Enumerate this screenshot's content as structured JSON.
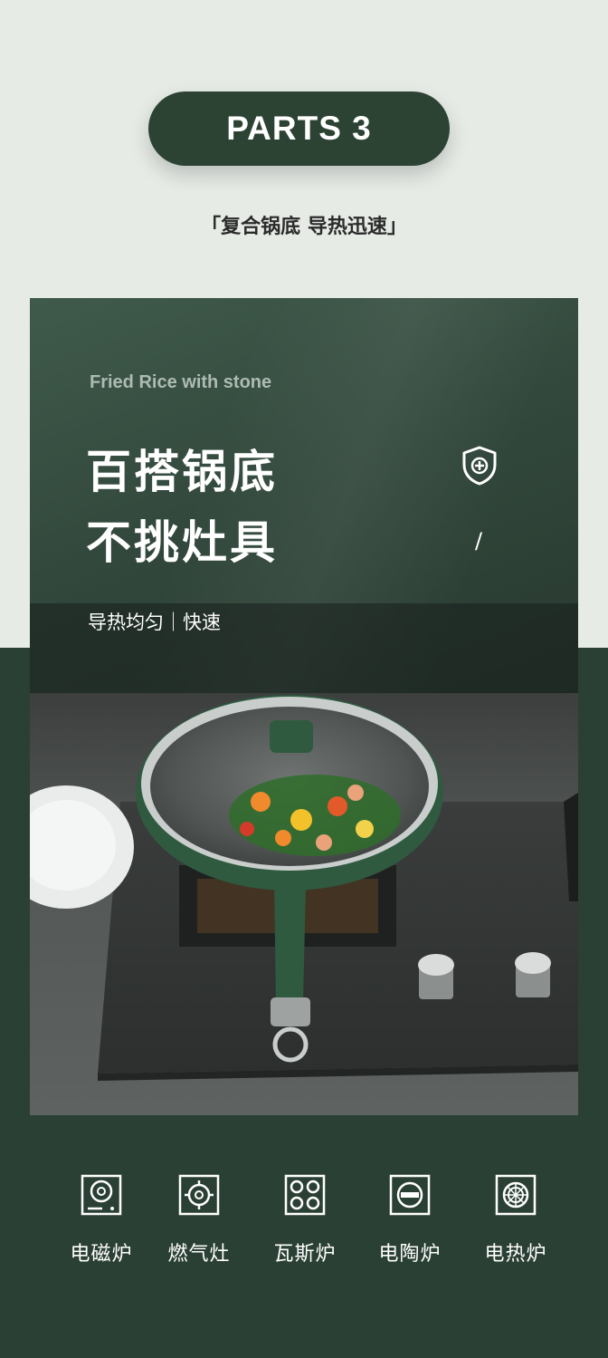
{
  "header": {
    "badge": "PARTS 3",
    "subtitle": "「复合锅底  导热迅速」"
  },
  "feature": {
    "english_caption": "Fried Rice with stone",
    "headline_line1": "百搭锅底",
    "headline_line2": "不挑灶具",
    "slash": "/",
    "band_text": "导热均匀｜快速"
  },
  "stoves": [
    {
      "label": "电磁炉",
      "icon": "induction-cooker-icon"
    },
    {
      "label": "燃气灶",
      "icon": "gas-stove-icon"
    },
    {
      "label": "瓦斯炉",
      "icon": "four-burner-stove-icon"
    },
    {
      "label": "电陶炉",
      "icon": "ceramic-cooker-icon"
    },
    {
      "label": "电热炉",
      "icon": "electric-heater-icon"
    }
  ],
  "colors": {
    "dark_green": "#2b4034",
    "light_bg": "#e6ebe6",
    "pan_green": "#2f5a40"
  }
}
